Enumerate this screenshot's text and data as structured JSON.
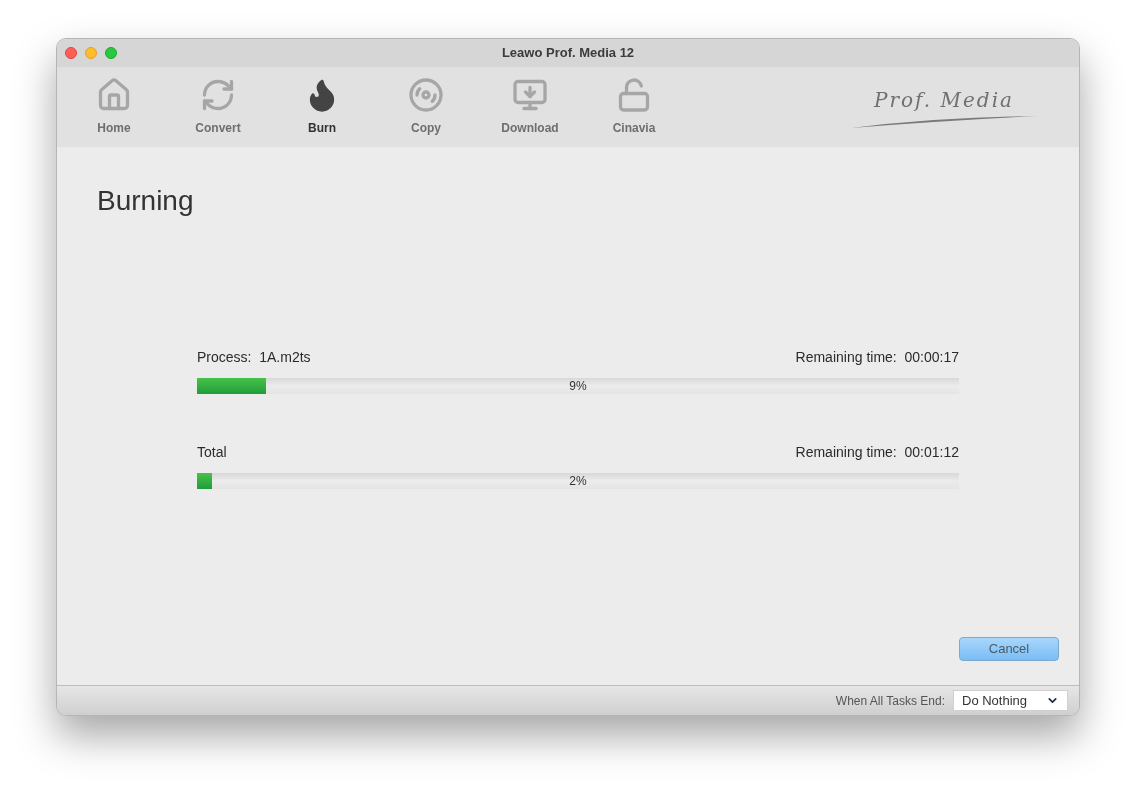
{
  "window": {
    "title": "Leawo Prof. Media 12"
  },
  "toolbar": [
    {
      "label": "Home",
      "kind": "home",
      "selected": false
    },
    {
      "label": "Convert",
      "kind": "convert",
      "selected": false
    },
    {
      "label": "Burn",
      "kind": "burn",
      "selected": true
    },
    {
      "label": "Copy",
      "kind": "copy",
      "selected": false
    },
    {
      "label": "Download",
      "kind": "download",
      "selected": false
    },
    {
      "label": "Cinavia",
      "kind": "cinavia",
      "selected": false
    }
  ],
  "logo": "Prof. Media",
  "heading": "Burning",
  "progress": [
    {
      "label": "Process:  1A.m2ts",
      "remaining": "Remaining time:  00:00:17",
      "level": 0.09,
      "percent": "9%"
    },
    {
      "label": "Total",
      "remaining": "Remaining time:  00:01:12",
      "level": 0.02,
      "percent": "2%"
    }
  ],
  "cancel_button": "Cancel",
  "status_bar": {
    "label": "When All Tasks End:",
    "value": "Do Nothing"
  }
}
